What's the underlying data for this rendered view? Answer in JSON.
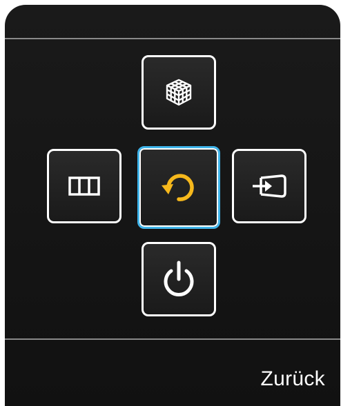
{
  "menu": {
    "back_label": "Zurück",
    "accent_color": "#3fb4ea",
    "highlight_icon_color": "#f6b81c",
    "buttons": [
      {
        "position": "top",
        "icon": "cube-grid-icon"
      },
      {
        "position": "left",
        "icon": "columns-icon"
      },
      {
        "position": "center",
        "icon": "return-arrow-icon",
        "focused": true
      },
      {
        "position": "right",
        "icon": "input-source-icon"
      },
      {
        "position": "bottom",
        "icon": "power-icon"
      }
    ]
  }
}
